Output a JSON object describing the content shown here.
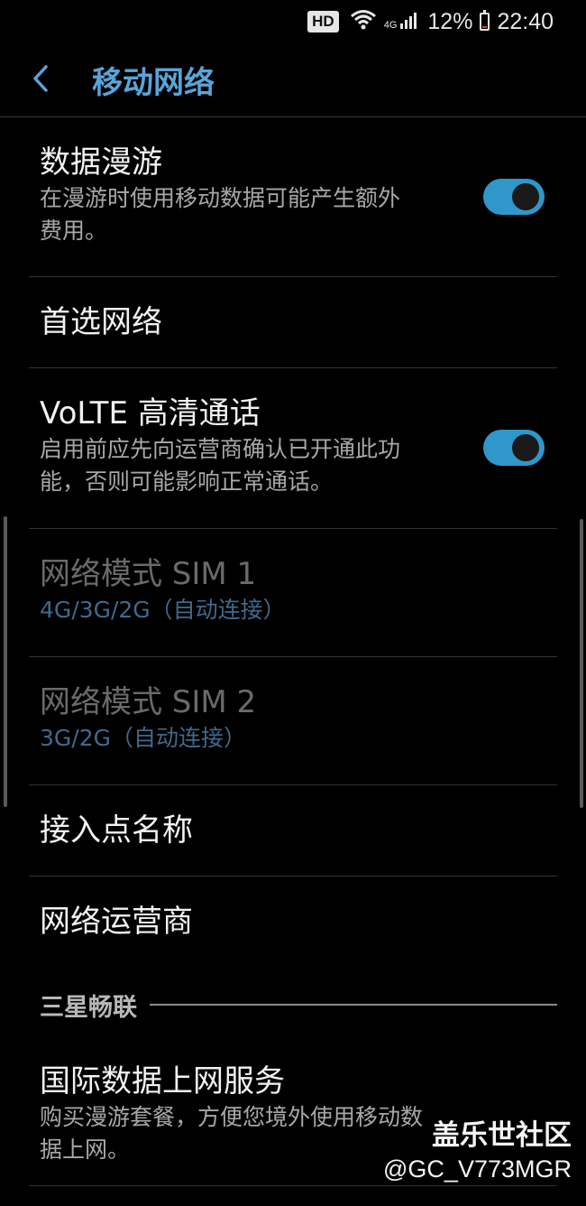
{
  "status": {
    "hd": "HD",
    "network": "4G",
    "battery_percent": "12%",
    "battery_level": 0.12,
    "time": "22:40"
  },
  "header": {
    "title": "移动网络",
    "back_icon": "chevron-left-icon"
  },
  "items": [
    {
      "title": "数据漫游",
      "subtitle": "在漫游时使用移动数据可能产生额外费用。",
      "toggle_on": true
    },
    {
      "title": "首选网络"
    },
    {
      "title": "VoLTE 高清通话",
      "subtitle": "启用前应先向运营商确认已开通此功能，否则可能影响正常通话。",
      "toggle_on": true
    },
    {
      "title": "网络模式 SIM 1",
      "subtitle": "4G/3G/2G（自动连接）",
      "disabled": true
    },
    {
      "title": "网络模式 SIM 2",
      "subtitle": "3G/2G（自动连接）",
      "disabled": true
    },
    {
      "title": "接入点名称"
    },
    {
      "title": "网络运营商"
    }
  ],
  "section": {
    "title": "三星畅联"
  },
  "section_items": [
    {
      "title": "国际数据上网服务",
      "subtitle": "购买漫游套餐，方便您境外使用移动数据上网。"
    }
  ],
  "watermark": {
    "main": "盖乐世社区",
    "sub": "@GC_V773MGR"
  },
  "colors": {
    "accent": "#2f97c9",
    "title": "#5aa4d8",
    "background": "#000000"
  }
}
